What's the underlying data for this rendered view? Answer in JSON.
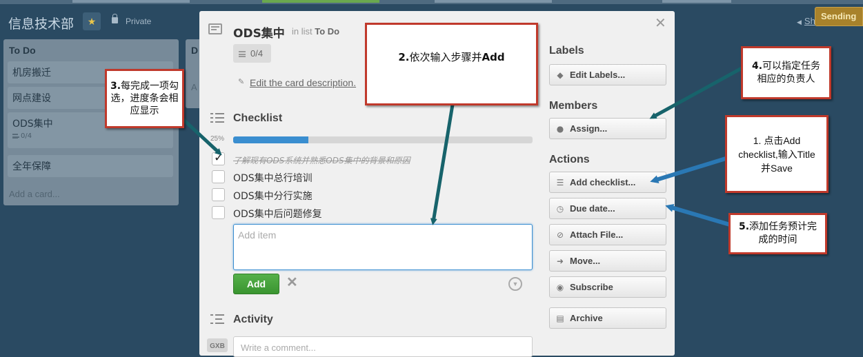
{
  "board": {
    "title": "信息技术部",
    "visibility": "Private",
    "share_label": "Sh",
    "sending_label": "Sending"
  },
  "lists": {
    "todo": {
      "title": "To Do",
      "cards": [
        "机房搬迁",
        "网点建设",
        "ODS集中",
        "全年保障"
      ],
      "card_badge": "0/4",
      "add_card": "Add a card..."
    },
    "doing": {
      "title": "D",
      "add_label": "A"
    }
  },
  "card": {
    "title": "ODS集中",
    "in_list_prefix": "in list",
    "list_name": "To Do",
    "checklist_badge": "0/4",
    "edit_description": "Edit the card description."
  },
  "checklist": {
    "title": "Checklist",
    "progress_label": "25%",
    "progress": 0.25,
    "items": [
      {
        "label": "了解现有ODS系统并熟悉ODS集中的背景和原因",
        "done": true
      },
      {
        "label": "ODS集中总行培训",
        "done": false
      },
      {
        "label": "ODS集中分行实施",
        "done": false
      },
      {
        "label": "ODS集中后问题修复",
        "done": false
      }
    ],
    "add_item_placeholder": "Add item",
    "add_button": "Add"
  },
  "activity": {
    "title": "Activity",
    "avatar_initials": "GXB",
    "comment_placeholder": "Write a comment..."
  },
  "sidebar": {
    "labels_title": "Labels",
    "edit_labels": "Edit Labels...",
    "members_title": "Members",
    "assign": "Assign...",
    "actions_title": "Actions",
    "add_checklist": "Add checklist...",
    "due_date": "Due date...",
    "attach_file": "Attach File...",
    "move": "Move...",
    "subscribe": "Subscribe",
    "archive": "Archive"
  },
  "annotations": {
    "step1": "1. 点击Add checklist,输入Title并Save",
    "step2_num": "2.",
    "step2_text": "依次输入步骤并",
    "step2_bold": "Add",
    "step3_num": "3.",
    "step3_text": "每完成一项勾选，进度条会相应显示",
    "step4_num": "4.",
    "step4_text": "可以指定任务相应的负责人",
    "step5_num": "5.",
    "step5_text": "添加任务预计完成的时间"
  }
}
